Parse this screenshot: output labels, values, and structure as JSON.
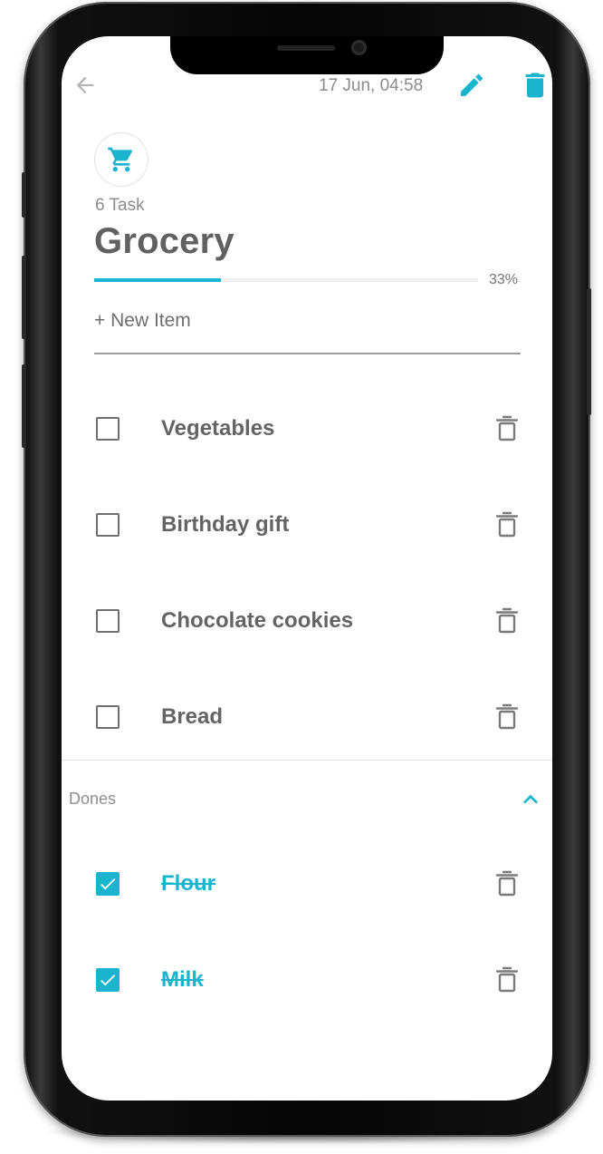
{
  "header": {
    "datetime": "17 Jun, 04:58",
    "icons": {
      "back": "arrow-back-icon",
      "edit": "pencil-icon",
      "delete": "trash-icon"
    }
  },
  "list": {
    "icon": "shopping-cart-icon",
    "task_count": "6 Task",
    "title": "Grocery",
    "progress_fraction": 0.33,
    "progress_label": "33%"
  },
  "new_item": {
    "label": "+ New Item"
  },
  "todo_items": [
    {
      "label": "Vegetables",
      "checked": false
    },
    {
      "label": "Birthday gift",
      "checked": false
    },
    {
      "label": "Chocolate cookies",
      "checked": false
    },
    {
      "label": "Bread",
      "checked": false
    }
  ],
  "dones": {
    "label": "Dones",
    "expanded": true,
    "items": [
      {
        "label": "Flour",
        "checked": true
      },
      {
        "label": "Milk",
        "checked": true
      }
    ]
  },
  "colors": {
    "accent": "#1ab4cf",
    "text": "#646464",
    "muted": "#8c8c8c"
  }
}
